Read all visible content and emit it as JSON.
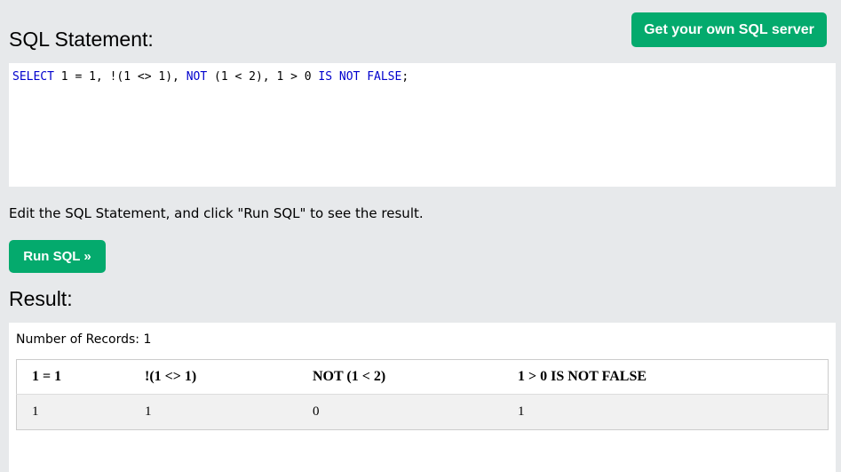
{
  "header": {
    "get_server_label": "Get your own SQL server",
    "statement_title": "SQL Statement:"
  },
  "editor": {
    "tokens": [
      {
        "text": "SELECT",
        "kw": true
      },
      {
        "text": " 1 = 1, !(1 <> 1), ",
        "kw": false
      },
      {
        "text": "NOT",
        "kw": true
      },
      {
        "text": " (1 < 2), 1 > 0 ",
        "kw": false
      },
      {
        "text": "IS",
        "kw": true
      },
      {
        "text": " ",
        "kw": false
      },
      {
        "text": "NOT",
        "kw": true
      },
      {
        "text": " ",
        "kw": false
      },
      {
        "text": "FALSE",
        "kw": true
      },
      {
        "text": ";",
        "kw": false
      }
    ],
    "keyword_color": "#0000cd"
  },
  "hint": "Edit the SQL Statement, and click \"Run SQL\" to see the result.",
  "run_button_label": "Run SQL »",
  "result": {
    "title": "Result:",
    "records_label": "Number of Records: 1",
    "columns": [
      "1 = 1",
      "!(1 <> 1)",
      "NOT (1 < 2)",
      "1 > 0 IS NOT FALSE"
    ],
    "rows": [
      [
        "1",
        "1",
        "0",
        "1"
      ]
    ]
  },
  "colors": {
    "accent": "#04aa6d",
    "page_background": "#e7e9eb"
  }
}
